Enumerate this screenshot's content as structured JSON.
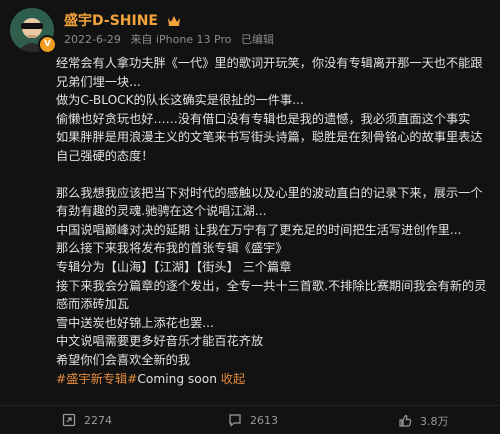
{
  "post": {
    "author": "盛宇D-SHINE",
    "date": "2022-6-29",
    "device": "来自 iPhone 13 Pro",
    "edited": "已编辑",
    "paragraphs": [
      "经常会有人拿功夫胖《一代》里的歌词开玩笑，你没有专辑离开那一天也不能跟兄弟们埋一块...",
      "做为C-BLOCK的队长这确实是很扯的一件事...",
      "偷懒也好贪玩也好……没有借口没有专辑也是我的遗憾，我必须直面这个事实",
      "如果胖胖是用浪漫主义的文笔来书写街头诗篇，聪胜是在刻骨铭心的故事里表达自己强硬的态度！",
      "",
      "那么我想我应该把当下对时代的感触以及心里的波动直白的记录下来，展示一个有劲有趣的灵魂.驰骋在这个说唱江湖...",
      "中国说唱巅峰对决的延期 让我在万宁有了更充足的时间把生活写进创作里...",
      "那么接下来我将发布我的首张专辑《盛宇》",
      "专辑分为【山海】【江湖】【街头】 三个篇章",
      "接下来我会分篇章的逐个发出，全专一共十三首歌.不排除比赛期间我会有新的灵感而添砖加瓦",
      "雪中送炭也好锦上添花也罢...",
      "中文说唱需要更多好音乐才能百花齐放",
      "希望你们会喜欢全新的我"
    ],
    "hashtag": "#盛宇新专辑#",
    "coming_soon": "Coming soon",
    "collapse": "收起"
  },
  "actions": {
    "repost_count": "2274",
    "comment_count": "2613",
    "like_count": "3.8万"
  },
  "colors": {
    "background": "#121212",
    "name": "#f2a33b",
    "link": "#e38a3b",
    "verified_badge": "#f29c1f"
  }
}
